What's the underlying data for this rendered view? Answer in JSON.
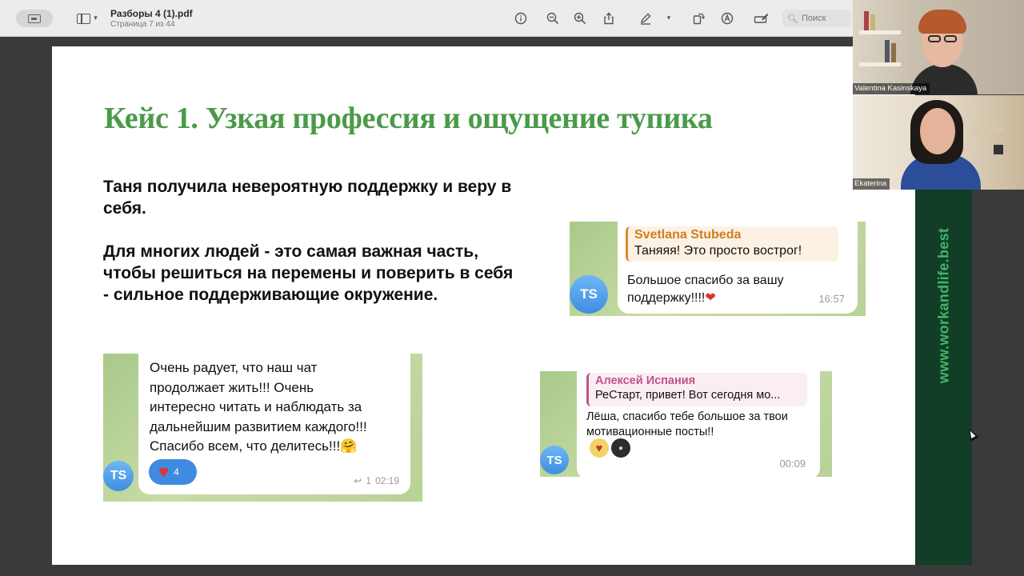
{
  "viewer": {
    "title": "Разборы 4 (1).pdf",
    "page_info": "Страница 7 из 44",
    "search_placeholder": "Поиск",
    "icons": [
      "sidebar-icon",
      "info-icon",
      "zoom-out-icon",
      "zoom-in-icon",
      "share-icon",
      "markup-pen-icon",
      "chevron-down-icon",
      "rotate-icon",
      "annotate-icon",
      "form-fill-icon",
      "search-icon"
    ]
  },
  "slide": {
    "title": "Кейс 1. Узкая профессия и ощущение тупика",
    "paragraph1": "Таня получила невероятную поддержку и веру в себя.",
    "paragraph2": "Для многих людей - это самая важная часть, чтобы решиться на перемены и поверить в себя - сильное поддерживающие окружение.",
    "side_url": "www.workandlife.best",
    "colors": {
      "title": "#4a9a4a",
      "band": "#123d26",
      "url": "#43b36b"
    }
  },
  "chats": {
    "chat1": {
      "message": "Очень радует, что наш чат\nпродолжает жить!!! Очень\nинтересно читать и наблюдать за\nдальнейшим развитием каждого!!!\nСпасибо всем, что делитесь!!!🤗",
      "reaction_count": "4",
      "reply_count": "1",
      "time": "02:19",
      "avatar": "TS"
    },
    "chat2": {
      "quote_author": "Svetlana Stubeda",
      "quote_text": "Таняяя! Это просто вострог!",
      "message": "Большое спасибо за вашу\nподдержку!!!!",
      "time": "16:57",
      "avatar": "TS"
    },
    "chat3": {
      "quote_author": "Алексей Испания",
      "quote_text": "РеСтарт, привет! Вот сегодня мо...",
      "message": "Лёша, спасибо тебе большое за твои\nмотивационные посты!!",
      "time": "00:09",
      "avatar": "TS"
    }
  },
  "participants": [
    {
      "name": "Valentina Kasinskaya"
    },
    {
      "name": "Ekaterina"
    }
  ]
}
